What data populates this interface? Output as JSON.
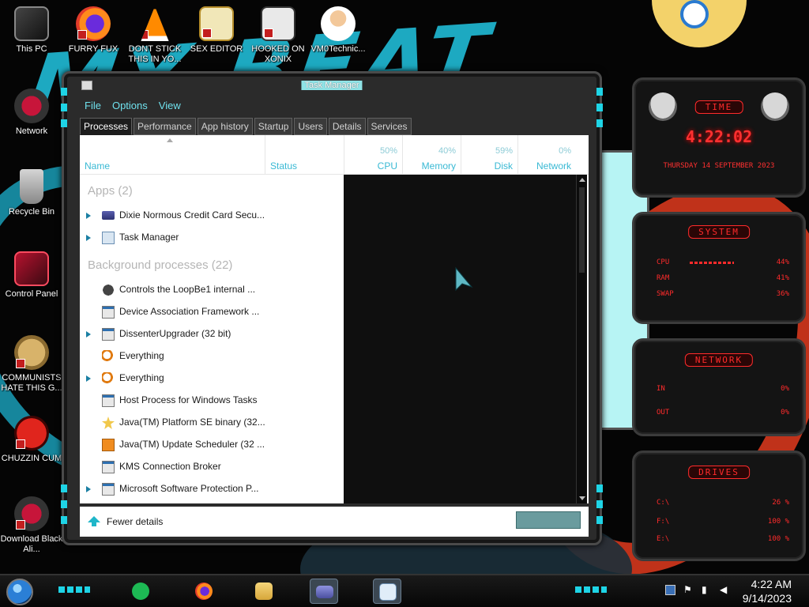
{
  "desktop": {
    "icons": [
      {
        "label": "This PC",
        "icon": "computer-icon"
      },
      {
        "label": "FURRY FUX",
        "icon": "firefox-icon"
      },
      {
        "label": "DONT STICK THIS IN YO...",
        "icon": "vlc-icon"
      },
      {
        "label": "SEX EDITOR",
        "icon": "hex-editor-icon"
      },
      {
        "label": "HOOKED ON XONIX",
        "icon": "xonix-game-icon"
      },
      {
        "label": "VM0Technic...",
        "icon": "doctor-avatar-icon"
      },
      {
        "label": "Network",
        "icon": "network-alien-icon"
      },
      {
        "label": "Recycle Bin",
        "icon": "recycle-bin-icon"
      },
      {
        "label": "Control Panel",
        "icon": "control-panel-icon"
      },
      {
        "label": "COMMUNISTS HATE THIS G...",
        "icon": "money-bag-icon"
      },
      {
        "label": "CHUZZIN CUM",
        "icon": "chuzzle-icon"
      },
      {
        "label": "Download Black Ali...",
        "icon": "download-alien-icon"
      }
    ]
  },
  "gadgets": {
    "clock": {
      "title": "TIME",
      "time": "4:22:02",
      "date": "THURSDAY 14 SEPTEMBER 2023"
    },
    "system": {
      "title": "SYSTEM",
      "rows": [
        {
          "label": "CPU",
          "value": "44%"
        },
        {
          "label": "RAM",
          "value": "41%"
        },
        {
          "label": "SWAP",
          "value": "36%"
        }
      ]
    },
    "network": {
      "title": "NETWORK",
      "rows": [
        {
          "label": "IN",
          "value": "0%"
        },
        {
          "label": "OUT",
          "value": "0%"
        }
      ]
    },
    "drives": {
      "title": "DRIVES",
      "rows": [
        {
          "label": "C:\\",
          "value": "26 %"
        },
        {
          "label": "F:\\",
          "value": "100 %"
        },
        {
          "label": "E:\\",
          "value": "100 %"
        }
      ]
    }
  },
  "task_manager": {
    "title": "Task Manager",
    "menu": [
      "File",
      "Options",
      "View"
    ],
    "tabs": [
      "Processes",
      "Performance",
      "App history",
      "Startup",
      "Users",
      "Details",
      "Services"
    ],
    "active_tab": "Processes",
    "columns": {
      "name": "Name",
      "status": "Status",
      "cpu": {
        "label": "CPU",
        "pct": "50%"
      },
      "memory": {
        "label": "Memory",
        "pct": "40%"
      },
      "disk": {
        "label": "Disk",
        "pct": "59%"
      },
      "network": {
        "label": "Network",
        "pct": "0%"
      }
    },
    "apps_group": "Apps (2)",
    "apps": [
      {
        "name": "Dixie Normous Credit Card Secu...",
        "icon": "credit-card-app-icon",
        "expandable": true
      },
      {
        "name": "Task Manager",
        "icon": "task-manager-icon",
        "expandable": true
      }
    ],
    "bg_group": "Background processes (22)",
    "background": [
      {
        "name": "Controls the LoopBe1 internal ...",
        "icon": "mouse-icon",
        "expandable": false
      },
      {
        "name": "Device Association Framework ...",
        "icon": "window-icon",
        "expandable": false
      },
      {
        "name": "DissenterUpgrader (32 bit)",
        "icon": "window-icon",
        "expandable": true
      },
      {
        "name": "Everything",
        "icon": "magnifier-icon",
        "expandable": false
      },
      {
        "name": "Everything",
        "icon": "magnifier-icon",
        "expandable": true
      },
      {
        "name": "Host Process for Windows Tasks",
        "icon": "window-icon",
        "expandable": false
      },
      {
        "name": "Java(TM) Platform SE binary (32...",
        "icon": "java-icon",
        "expandable": false
      },
      {
        "name": "Java(TM) Update Scheduler (32 ...",
        "icon": "java-update-icon",
        "expandable": false
      },
      {
        "name": "KMS Connection Broker",
        "icon": "window-icon",
        "expandable": false
      },
      {
        "name": "Microsoft Software Protection P...",
        "icon": "window-icon",
        "expandable": true
      }
    ],
    "footer": {
      "fewer_details": "Fewer details"
    }
  },
  "taskbar": {
    "apps": [
      {
        "name": "spotify",
        "icon": "spotify-icon"
      },
      {
        "name": "firefox",
        "icon": "firefox-icon"
      },
      {
        "name": "file-explorer",
        "icon": "folder-icon"
      },
      {
        "name": "dixie-credit-card",
        "icon": "credit-card-app-icon"
      },
      {
        "name": "task-manager",
        "icon": "task-manager-icon"
      }
    ],
    "tray": [
      "monitor-icon",
      "flag-icon",
      "network-icon",
      "volume-icon"
    ],
    "time": "4:22 AM",
    "date": "9/14/2023"
  }
}
